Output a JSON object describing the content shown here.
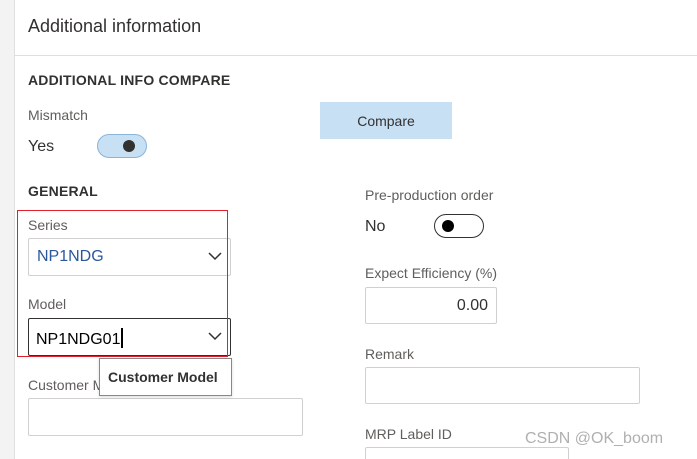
{
  "panel": {
    "title": "Additional information"
  },
  "additional_info_compare": {
    "section_title": "ADDITIONAL INFO COMPARE",
    "mismatch": {
      "label": "Mismatch",
      "value": "Yes",
      "toggle_on": true
    },
    "compare_button": "Compare"
  },
  "general": {
    "section_title": "GENERAL",
    "series": {
      "label": "Series",
      "value": "NP1NDG"
    },
    "model": {
      "label": "Model",
      "value": "NP1NDG01"
    },
    "customer_model": {
      "label": "Customer M",
      "tooltip": "Customer Model",
      "value": ""
    },
    "pre_production_order": {
      "label": "Pre-production order",
      "value": "No",
      "toggle_on": false
    },
    "expect_efficiency": {
      "label": "Expect Efficiency (%)",
      "value": "0.00"
    },
    "remark": {
      "label": "Remark",
      "value": ""
    },
    "mrp_label_id": {
      "label": "MRP Label ID",
      "value": ""
    }
  },
  "watermark": "CSDN @OK_boom",
  "colors": {
    "toggle_on_bg": "#c7e0f4",
    "button_bg": "#c7e0f4",
    "link_value": "#2b579a",
    "highlight_border": "#e0202a"
  }
}
